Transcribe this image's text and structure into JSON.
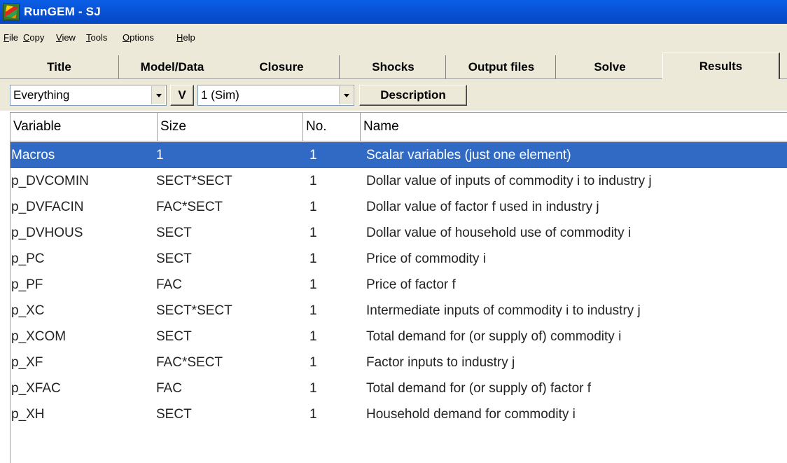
{
  "window": {
    "title": "RunGEM - SJ",
    "icon": "rungem-app-icon"
  },
  "menu": [
    {
      "label": "File",
      "ul": "F",
      "rest": "ile"
    },
    {
      "label": "Copy",
      "ul": "C",
      "rest": "opy"
    },
    {
      "label": "View",
      "ul": "V",
      "rest": "iew"
    },
    {
      "label": "Tools",
      "ul": "T",
      "rest": "ools"
    },
    {
      "label": "Options",
      "ul": "O",
      "rest": "ptions"
    },
    {
      "label": "Help",
      "ul": "H",
      "rest": "elp"
    }
  ],
  "tabs": [
    "Title",
    "Model/Data",
    "Closure",
    "Shocks",
    "Output files",
    "Solve",
    "Results"
  ],
  "active_tab": "Results",
  "toolbar": {
    "filter_value": "Everything",
    "v_button": "V",
    "sim_value": "1 (Sim)",
    "description_button": "Description"
  },
  "table": {
    "headers": [
      "Variable",
      "Size",
      "No.",
      "Name"
    ],
    "rows": [
      {
        "variable": "Macros",
        "size": "1",
        "no": "1",
        "name": "Scalar variables (just one element)",
        "selected": true
      },
      {
        "variable": "p_DVCOMIN",
        "size": "SECT*SECT",
        "no": "1",
        "name": "Dollar value of inputs of commodity i to industry j"
      },
      {
        "variable": "p_DVFACIN",
        "size": "FAC*SECT",
        "no": "1",
        "name": "Dollar value of factor f used in industry j"
      },
      {
        "variable": "p_DVHOUS",
        "size": "SECT",
        "no": "1",
        "name": "Dollar value of household use of commodity i"
      },
      {
        "variable": "p_PC",
        "size": "SECT",
        "no": "1",
        "name": "Price of commodity i"
      },
      {
        "variable": "p_PF",
        "size": "FAC",
        "no": "1",
        "name": "Price of factor f"
      },
      {
        "variable": "p_XC",
        "size": "SECT*SECT",
        "no": "1",
        "name": "Intermediate inputs of commodity i to industry j"
      },
      {
        "variable": "p_XCOM",
        "size": "SECT",
        "no": "1",
        "name": "Total demand for (or supply of) commodity i"
      },
      {
        "variable": "p_XF",
        "size": "FAC*SECT",
        "no": "1",
        "name": "Factor inputs to industry j"
      },
      {
        "variable": "p_XFAC",
        "size": "FAC",
        "no": "1",
        "name": "Total demand for (or supply of) factor f"
      },
      {
        "variable": "p_XH",
        "size": "SECT",
        "no": "1",
        "name": "Household demand for commodity i"
      }
    ]
  },
  "colors": {
    "titlebar": "#0854d8",
    "selection": "#316ac5",
    "chrome": "#ece9d8"
  }
}
